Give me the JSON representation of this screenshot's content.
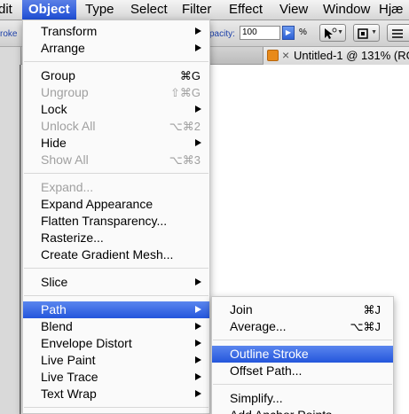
{
  "menubar": {
    "items": [
      {
        "label": "dit"
      },
      {
        "label": "Object"
      },
      {
        "label": "Type"
      },
      {
        "label": "Select"
      },
      {
        "label": "Filter"
      },
      {
        "label": "Effect"
      },
      {
        "label": "View"
      },
      {
        "label": "Window"
      },
      {
        "label": "Hjæ"
      }
    ]
  },
  "controlbar": {
    "stroke_label": "roke",
    "opacity_label": "pacity:",
    "opacity_value": "100",
    "opacity_unit": "%"
  },
  "document": {
    "tab_title": "Untitled-1 @ 131% (RG",
    "close_glyph": "×"
  },
  "object_menu": {
    "items": [
      {
        "label": "Transform",
        "shortcut": "",
        "submenu": true,
        "disabled": false
      },
      {
        "label": "Arrange",
        "shortcut": "",
        "submenu": true,
        "disabled": false
      },
      {
        "label": "Group",
        "shortcut": "⌘G",
        "submenu": false,
        "disabled": false
      },
      {
        "label": "Ungroup",
        "shortcut": "⇧⌘G",
        "submenu": false,
        "disabled": true
      },
      {
        "label": "Lock",
        "shortcut": "",
        "submenu": true,
        "disabled": false
      },
      {
        "label": "Unlock All",
        "shortcut": "⌥⌘2",
        "submenu": false,
        "disabled": true
      },
      {
        "label": "Hide",
        "shortcut": "",
        "submenu": true,
        "disabled": false
      },
      {
        "label": "Show All",
        "shortcut": "⌥⌘3",
        "submenu": false,
        "disabled": true
      },
      {
        "label": "Expand...",
        "shortcut": "",
        "submenu": false,
        "disabled": true
      },
      {
        "label": "Expand Appearance",
        "shortcut": "",
        "submenu": false,
        "disabled": false
      },
      {
        "label": "Flatten Transparency...",
        "shortcut": "",
        "submenu": false,
        "disabled": false
      },
      {
        "label": "Rasterize...",
        "shortcut": "",
        "submenu": false,
        "disabled": false
      },
      {
        "label": "Create Gradient Mesh...",
        "shortcut": "",
        "submenu": false,
        "disabled": false
      },
      {
        "label": "Slice",
        "shortcut": "",
        "submenu": true,
        "disabled": false
      },
      {
        "label": "Path",
        "shortcut": "",
        "submenu": true,
        "disabled": false,
        "highlighted": true
      },
      {
        "label": "Blend",
        "shortcut": "",
        "submenu": true,
        "disabled": false
      },
      {
        "label": "Envelope Distort",
        "shortcut": "",
        "submenu": true,
        "disabled": false
      },
      {
        "label": "Live Paint",
        "shortcut": "",
        "submenu": true,
        "disabled": false
      },
      {
        "label": "Live Trace",
        "shortcut": "",
        "submenu": true,
        "disabled": false
      },
      {
        "label": "Text Wrap",
        "shortcut": "",
        "submenu": true,
        "disabled": false
      }
    ]
  },
  "path_submenu": {
    "items": [
      {
        "label": "Join",
        "shortcut": "⌘J"
      },
      {
        "label": "Average...",
        "shortcut": "⌥⌘J"
      },
      {
        "label": "Outline Stroke",
        "shortcut": "",
        "highlighted": true
      },
      {
        "label": "Offset Path...",
        "shortcut": ""
      },
      {
        "label": "Simplify...",
        "shortcut": ""
      },
      {
        "label": "Add Anchor Points",
        "shortcut": ""
      }
    ]
  },
  "colors": {
    "highlight": "#2456dc",
    "disabled_text": "#a0a0a0",
    "menu_bg": "#fafafa"
  }
}
